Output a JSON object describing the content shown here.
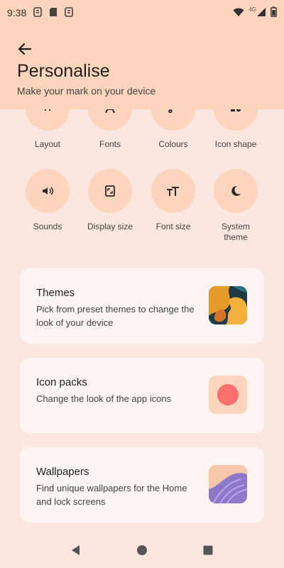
{
  "status_bar": {
    "time": "9:38",
    "network": "4G"
  },
  "header": {
    "title": "Personalise",
    "subtitle": "Make your mark on your device"
  },
  "grid_row1": [
    {
      "label": "Layout",
      "icon": "layout-grid-icon"
    },
    {
      "label": "Fonts",
      "icon": "font-icon"
    },
    {
      "label": "Colours",
      "icon": "palette-brush-icon"
    },
    {
      "label": "Icon shape",
      "icon": "shape-icon"
    }
  ],
  "grid_row2": [
    {
      "label": "Sounds",
      "icon": "volume-icon"
    },
    {
      "label": "Display size",
      "icon": "display-size-icon"
    },
    {
      "label": "Font size",
      "icon": "font-size-icon"
    },
    {
      "label": "System theme",
      "icon": "moon-icon"
    }
  ],
  "cards": [
    {
      "title": "Themes",
      "description": "Pick from preset themes to change the look of your device"
    },
    {
      "title": "Icon packs",
      "description": "Change the look of the app icons"
    },
    {
      "title": "Wallpapers",
      "description": "Find unique wallpapers for the Home and lock screens"
    }
  ],
  "colors": {
    "background": "#fbe7df",
    "header": "#fdd5bd",
    "card": "#fdf5f2",
    "accent_dot": "#fc6f6f"
  }
}
